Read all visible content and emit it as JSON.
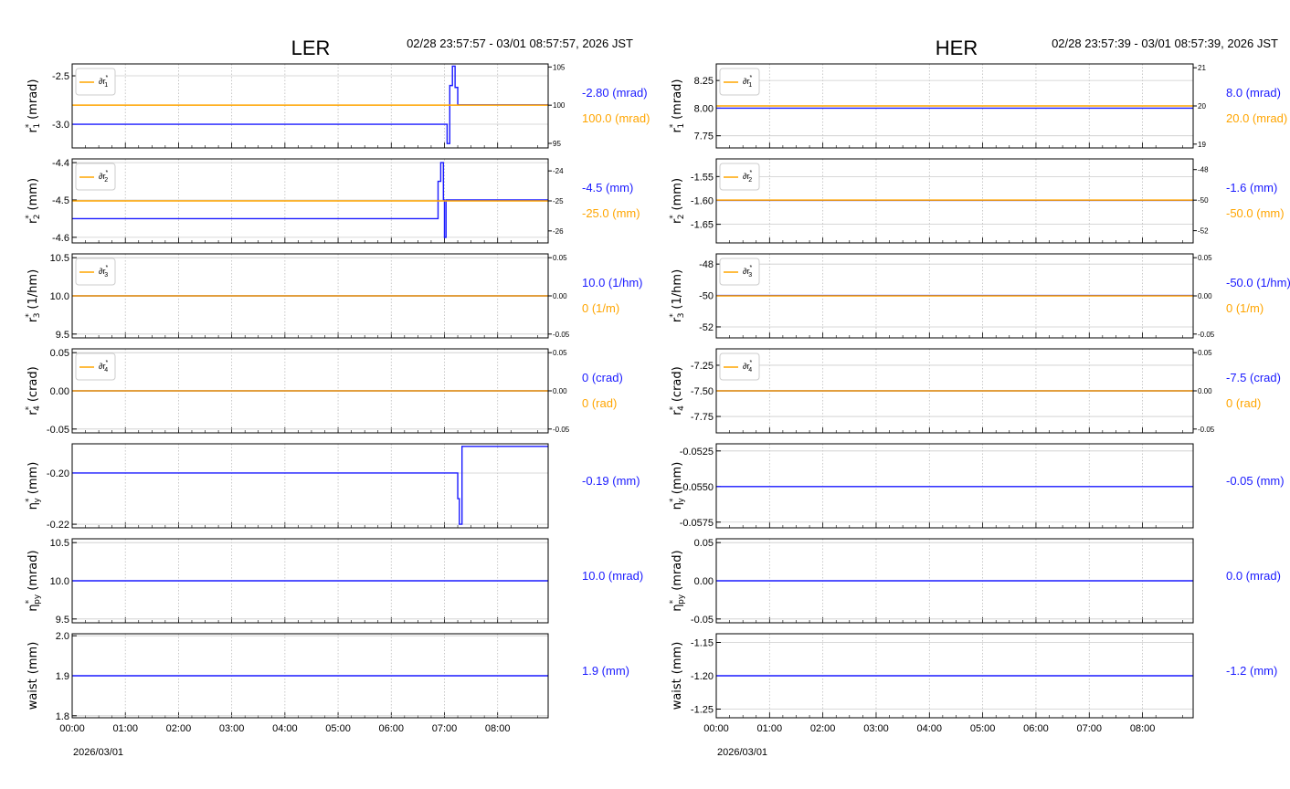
{
  "colors": {
    "blue": "#1a1aff",
    "orange": "#ffa500",
    "overlap": "#d9a0a0"
  },
  "time_axis": {
    "ticks": [
      "00:00",
      "01:00",
      "02:00",
      "03:00",
      "04:00",
      "05:00",
      "06:00",
      "07:00",
      "08:00"
    ],
    "date": "2026/03/01",
    "range_hours": [
      0,
      8.95
    ]
  },
  "chart_data": [
    {
      "type": "line",
      "title": "LER",
      "time_range": "02/28 23:57:57 - 03/01 08:57:57, 2026 JST",
      "panels": [
        {
          "ylabel": {
            "sym": "r",
            "sub": "1",
            "unit": "(mrad)"
          },
          "ylim": [
            -3.245,
            -2.377
          ],
          "yticks": [
            "-2.5",
            "-3.0"
          ],
          "ytick_values": [
            -2.5,
            -3.0
          ],
          "blue": [
            [
              0,
              -3.0
            ],
            [
              7.05,
              -3.0
            ],
            [
              7.05,
              -3.2
            ],
            [
              7.1,
              -3.2
            ],
            [
              7.1,
              -2.6
            ],
            [
              7.15,
              -2.6
            ],
            [
              7.15,
              -2.4
            ],
            [
              7.2,
              -2.4
            ],
            [
              7.2,
              -2.62
            ],
            [
              7.25,
              -2.62
            ],
            [
              7.25,
              -2.8
            ],
            [
              8.95,
              -2.8
            ]
          ],
          "legend": {
            "sym": "∂r",
            "sub": "1"
          },
          "rlim": [
            94.4,
            105.4
          ],
          "rticks": [
            "105",
            "100",
            "95"
          ],
          "rtick_values": [
            105,
            100,
            95
          ],
          "orange": [
            [
              0,
              100
            ],
            [
              8.95,
              100
            ]
          ],
          "readout_blue": "-2.80 (mrad)",
          "readout_orange": "100.0 (mrad)"
        },
        {
          "ylabel": {
            "sym": "r",
            "sub": "2",
            "unit": "(mm)"
          },
          "ylim": [
            -4.615,
            -4.39
          ],
          "yticks": [
            "-4.4",
            "-4.5",
            "-4.6"
          ],
          "ytick_values": [
            -4.4,
            -4.5,
            -4.6
          ],
          "blue": [
            [
              0,
              -4.55
            ],
            [
              6.88,
              -4.55
            ],
            [
              6.88,
              -4.45
            ],
            [
              6.93,
              -4.45
            ],
            [
              6.93,
              -4.4
            ],
            [
              6.98,
              -4.4
            ],
            [
              6.98,
              -4.5
            ],
            [
              7.0,
              -4.5
            ],
            [
              7.0,
              -4.6
            ],
            [
              7.03,
              -4.6
            ],
            [
              7.03,
              -4.5
            ],
            [
              8.95,
              -4.5
            ]
          ],
          "legend": {
            "sym": "∂r",
            "sub": "2"
          },
          "rlim": [
            -26.4,
            -23.6
          ],
          "rticks": [
            "-24",
            "-25",
            "-26"
          ],
          "rtick_values": [
            -24,
            -25,
            -26
          ],
          "orange": [
            [
              0,
              -25
            ],
            [
              8.95,
              -25
            ]
          ],
          "readout_blue": "-4.5 (mm)",
          "readout_orange": "-25.0 (mm)"
        },
        {
          "ylabel": {
            "sym": "r",
            "sub": "3",
            "unit": "(1/hm)"
          },
          "ylim": [
            9.45,
            10.55
          ],
          "yticks": [
            "10.5",
            "10.0",
            "9.5"
          ],
          "ytick_values": [
            10.5,
            10.0,
            9.5
          ],
          "blue": [
            [
              0,
              10.0
            ],
            [
              8.95,
              10.0
            ]
          ],
          "legend": {
            "sym": "∂r",
            "sub": "3"
          },
          "rlim": [
            -0.055,
            0.055
          ],
          "rticks": [
            "0.05",
            "0.00",
            "-0.05"
          ],
          "rtick_values": [
            0.05,
            0,
            -0.05
          ],
          "orange": [
            [
              0,
              0
            ],
            [
              8.95,
              0
            ]
          ],
          "readout_blue": "10.0 (1/hm)",
          "readout_orange": "0 (1/m)"
        },
        {
          "ylabel": {
            "sym": "r",
            "sub": "4",
            "unit": "(crad)"
          },
          "ylim": [
            -0.055,
            0.055
          ],
          "yticks": [
            "0.05",
            "0.00",
            "-0.05"
          ],
          "ytick_values": [
            0.05,
            0,
            -0.05
          ],
          "blue": [
            [
              0,
              0
            ],
            [
              8.95,
              0
            ]
          ],
          "legend": {
            "sym": "∂r",
            "sub": "4"
          },
          "rlim": [
            -0.055,
            0.055
          ],
          "rticks": [
            "0.05",
            "0.00",
            "-0.05"
          ],
          "rtick_values": [
            0.05,
            0,
            -0.05
          ],
          "orange": [
            [
              0,
              0
            ],
            [
              8.95,
              0
            ]
          ],
          "readout_blue": "0 (crad)",
          "readout_orange": "0 (rad)"
        },
        {
          "ylabel": {
            "sym": "η",
            "sub": "y",
            "unit": "(mm)"
          },
          "ylim": [
            -0.2214,
            -0.1886
          ],
          "yticks": [
            "-0.20",
            "-0.22"
          ],
          "ytick_values": [
            -0.2,
            -0.22
          ],
          "blue": [
            [
              0,
              -0.2
            ],
            [
              7.25,
              -0.2
            ],
            [
              7.25,
              -0.21
            ],
            [
              7.28,
              -0.21
            ],
            [
              7.28,
              -0.22
            ],
            [
              7.33,
              -0.22
            ],
            [
              7.33,
              -0.1896
            ],
            [
              8.95,
              -0.1896
            ]
          ],
          "readout_blue": "-0.19 (mm)"
        },
        {
          "ylabel": {
            "sym": "η",
            "sub": "py",
            "unit": "(mrad)"
          },
          "ylim": [
            9.45,
            10.55
          ],
          "yticks": [
            "10.5",
            "10.0",
            "9.5"
          ],
          "ytick_values": [
            10.5,
            10.0,
            9.5
          ],
          "blue": [
            [
              0,
              10.0
            ],
            [
              8.95,
              10.0
            ]
          ],
          "readout_blue": "10.0 (mrad)"
        },
        {
          "ylabel": {
            "sym": "waist",
            "sub": "",
            "unit": "(mm)"
          },
          "ylim": [
            1.795,
            2.005
          ],
          "yticks": [
            "2.0",
            "1.9",
            "1.8"
          ],
          "ytick_values": [
            2.0,
            1.9,
            1.8
          ],
          "blue": [
            [
              0,
              1.9
            ],
            [
              8.95,
              1.9
            ]
          ],
          "readout_blue": "1.9 (mm)"
        }
      ]
    },
    {
      "type": "line",
      "title": "HER",
      "time_range": "02/28 23:57:39 - 03/01 08:57:39, 2026 JST",
      "panels": [
        {
          "ylabel": {
            "sym": "r",
            "sub": "1",
            "unit": "(mrad)"
          },
          "ylim": [
            7.64,
            8.4
          ],
          "yticks": [
            "8.25",
            "8.00",
            "7.75"
          ],
          "ytick_values": [
            8.25,
            8.0,
            7.75
          ],
          "blue": [
            [
              0,
              8.0
            ],
            [
              8.95,
              8.0
            ]
          ],
          "legend": {
            "sym": "∂r",
            "sub": "1"
          },
          "rlim": [
            18.9,
            21.1
          ],
          "rticks": [
            "21",
            "20",
            "19"
          ],
          "rtick_values": [
            21,
            20,
            19
          ],
          "orange": [
            [
              0,
              20
            ],
            [
              8.95,
              20
            ]
          ],
          "readout_blue": "8.0 (mrad)",
          "readout_orange": "20.0 (mrad)"
        },
        {
          "ylabel": {
            "sym": "r",
            "sub": "2",
            "unit": "(mm)"
          },
          "ylim": [
            -1.689,
            -1.513
          ],
          "yticks": [
            "-1.55",
            "-1.60",
            "-1.65"
          ],
          "ytick_values": [
            -1.55,
            -1.6,
            -1.65
          ],
          "blue": [
            [
              0,
              -1.6
            ],
            [
              8.95,
              -1.6
            ]
          ],
          "legend": {
            "sym": "∂r",
            "sub": "2"
          },
          "rlim": [
            -52.8,
            -47.3
          ],
          "rticks": [
            "-48",
            "-50",
            "-52"
          ],
          "rtick_values": [
            -48,
            -50,
            -52
          ],
          "orange": [
            [
              0,
              -50
            ],
            [
              8.95,
              -50
            ]
          ],
          "readout_blue": "-1.6 (mm)",
          "readout_orange": "-50.0 (mm)"
        },
        {
          "ylabel": {
            "sym": "r",
            "sub": "3",
            "unit": "(1/hm)"
          },
          "ylim": [
            -52.7,
            -47.35
          ],
          "yticks": [
            "-48",
            "-50",
            "-52"
          ],
          "ytick_values": [
            -48,
            -50,
            -52
          ],
          "blue": [
            [
              0,
              -50
            ],
            [
              8.95,
              -50
            ]
          ],
          "legend": {
            "sym": "∂r",
            "sub": "3"
          },
          "rlim": [
            -0.055,
            0.055
          ],
          "rticks": [
            "0.05",
            "0.00",
            "-0.05"
          ],
          "rtick_values": [
            0.05,
            0,
            -0.05
          ],
          "orange": [
            [
              0,
              0
            ],
            [
              8.95,
              0
            ]
          ],
          "readout_blue": "-50.0 (1/hm)",
          "readout_orange": "0 (1/m)"
        },
        {
          "ylabel": {
            "sym": "r",
            "sub": "4",
            "unit": "(crad)"
          },
          "ylim": [
            -7.91,
            -7.09
          ],
          "yticks": [
            "-7.25",
            "-7.50",
            "-7.75"
          ],
          "ytick_values": [
            -7.25,
            -7.5,
            -7.75
          ],
          "blue": [
            [
              0,
              -7.5
            ],
            [
              8.95,
              -7.5
            ]
          ],
          "legend": {
            "sym": "∂r",
            "sub": "4"
          },
          "rlim": [
            -0.055,
            0.055
          ],
          "rticks": [
            "0.05",
            "0.00",
            "-0.05"
          ],
          "rtick_values": [
            0.05,
            0,
            -0.05
          ],
          "orange": [
            [
              0,
              0
            ],
            [
              8.95,
              0
            ]
          ],
          "readout_blue": "-7.5 (crad)",
          "readout_orange": "0 (rad)"
        },
        {
          "ylabel": {
            "sym": "η",
            "sub": "y",
            "unit": "(mm)"
          },
          "ylim": [
            -0.0579,
            -0.052
          ],
          "yticks": [
            "-0.0525",
            "-0.0550",
            "-0.0575"
          ],
          "ytick_values": [
            -0.0525,
            -0.055,
            -0.0575
          ],
          "blue": [
            [
              0,
              -0.055
            ],
            [
              8.95,
              -0.055
            ]
          ],
          "readout_blue": "-0.05 (mm)"
        },
        {
          "ylabel": {
            "sym": "η",
            "sub": "py",
            "unit": "(mrad)"
          },
          "ylim": [
            -0.055,
            0.055
          ],
          "yticks": [
            "0.05",
            "0.00",
            "-0.05"
          ],
          "ytick_values": [
            0.05,
            0,
            -0.05
          ],
          "blue": [
            [
              0,
              0
            ],
            [
              8.95,
              0
            ]
          ],
          "readout_blue": "0.0 (mrad)"
        },
        {
          "ylabel": {
            "sym": "waist",
            "sub": "",
            "unit": "(mm)"
          },
          "ylim": [
            -1.263,
            -1.137
          ],
          "yticks": [
            "-1.15",
            "-1.20",
            "-1.25"
          ],
          "ytick_values": [
            -1.15,
            -1.2,
            -1.25
          ],
          "blue": [
            [
              0,
              -1.2
            ],
            [
              8.95,
              -1.2
            ]
          ],
          "readout_blue": "-1.2 (mm)"
        }
      ]
    }
  ]
}
